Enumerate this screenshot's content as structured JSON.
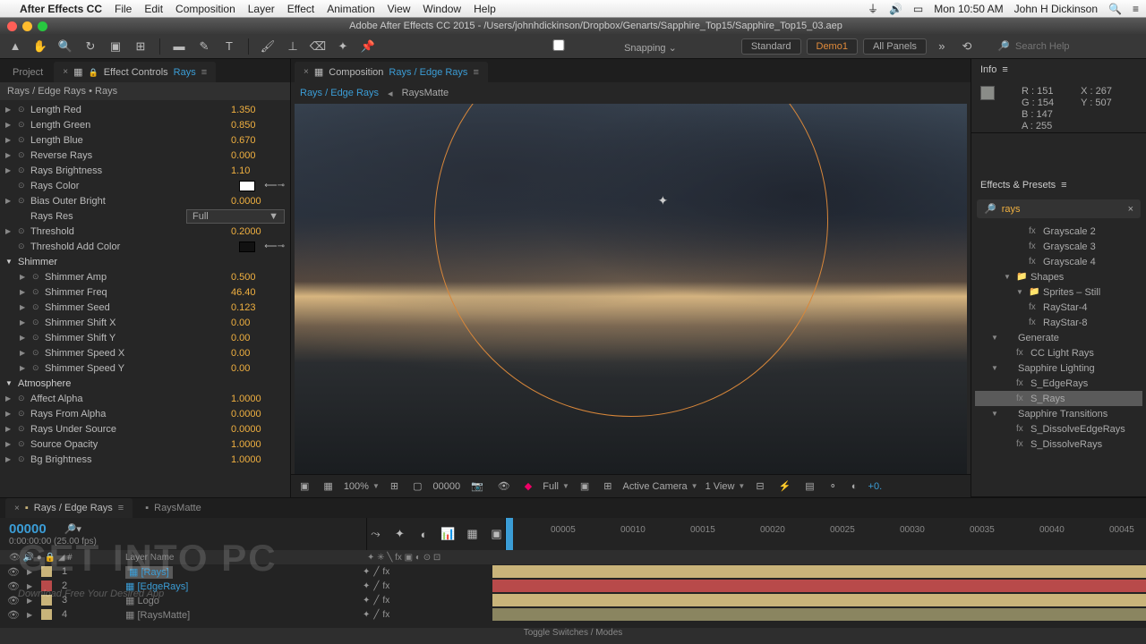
{
  "menubar": {
    "apple": "",
    "app": "After Effects CC",
    "items": [
      "File",
      "Edit",
      "Composition",
      "Layer",
      "Effect",
      "Animation",
      "View",
      "Window",
      "Help"
    ],
    "clock": "Mon 10:50 AM",
    "user": "John H Dickinson"
  },
  "titlebar": "Adobe After Effects CC 2015 - /Users/johnhdickinson/Dropbox/Genarts/Sapphire_Top15/Sapphire_Top15_03.aep",
  "toolbar": {
    "snapping": "Snapping",
    "standard": "Standard",
    "workspace": "Demo1",
    "allpanels": "All Panels",
    "search_placeholder": "Search Help"
  },
  "left": {
    "tab_project": "Project",
    "tab_ec": "Effect Controls",
    "tab_ec_target": "Rays",
    "subheader": "Rays / Edge Rays • Rays",
    "params": [
      {
        "t": "p",
        "label": "Length Red",
        "val": "1.350"
      },
      {
        "t": "p",
        "label": "Length Green",
        "val": "0.850"
      },
      {
        "t": "p",
        "label": "Length Blue",
        "val": "0.670"
      },
      {
        "t": "p",
        "label": "Reverse Rays",
        "val": "0.000"
      },
      {
        "t": "p",
        "label": "Rays Brightness",
        "val": "1.10"
      },
      {
        "t": "c",
        "label": "Rays Color",
        "swatch": "light"
      },
      {
        "t": "p",
        "label": "Bias Outer Bright",
        "val": "0.0000"
      },
      {
        "t": "d",
        "label": "Rays Res",
        "val": "Full"
      },
      {
        "t": "p",
        "label": "Threshold",
        "val": "0.2000"
      },
      {
        "t": "c",
        "label": "Threshold Add Color",
        "swatch": "dark"
      },
      {
        "t": "s",
        "label": "Shimmer"
      },
      {
        "t": "p",
        "label": "Shimmer Amp",
        "val": "0.500",
        "i": 1
      },
      {
        "t": "p",
        "label": "Shimmer Freq",
        "val": "46.40",
        "i": 1
      },
      {
        "t": "p",
        "label": "Shimmer Seed",
        "val": "0.123",
        "i": 1
      },
      {
        "t": "p",
        "label": "Shimmer Shift X",
        "val": "0.00",
        "i": 1
      },
      {
        "t": "p",
        "label": "Shimmer Shift Y",
        "val": "0.00",
        "i": 1
      },
      {
        "t": "p",
        "label": "Shimmer Speed X",
        "val": "0.00",
        "i": 1
      },
      {
        "t": "p",
        "label": "Shimmer Speed Y",
        "val": "0.00",
        "i": 1
      },
      {
        "t": "s",
        "label": "Atmosphere"
      },
      {
        "t": "p",
        "label": "Affect Alpha",
        "val": "1.0000"
      },
      {
        "t": "p",
        "label": "Rays From Alpha",
        "val": "0.0000"
      },
      {
        "t": "p",
        "label": "Rays Under Source",
        "val": "0.0000"
      },
      {
        "t": "p",
        "label": "Source Opacity",
        "val": "1.0000"
      },
      {
        "t": "p",
        "label": "Bg Brightness",
        "val": "1.0000"
      }
    ]
  },
  "center": {
    "tab": "Composition",
    "crumb1": "Rays / Edge Rays",
    "crumb_active": "Rays / Edge Rays",
    "crumb_next": "RaysMatte",
    "zoom": "100%",
    "timecode": "00000",
    "res": "Full",
    "camera": "Active Camera",
    "views": "1 View",
    "exp": "+0."
  },
  "right": {
    "info": "Info",
    "r": "R : 151",
    "g": "G : 154",
    "b": "B : 147",
    "a": "A : 255",
    "x": "X : 267",
    "y": "Y : 507",
    "ep": "Effects & Presets",
    "search": "rays",
    "tree": [
      {
        "t": "i",
        "label": "Grayscale 2",
        "ind": 3
      },
      {
        "t": "i",
        "label": "Grayscale 3",
        "ind": 3
      },
      {
        "t": "i",
        "label": "Grayscale 4",
        "ind": 3
      },
      {
        "t": "f",
        "label": "Shapes",
        "ind": 2,
        "open": true
      },
      {
        "t": "f",
        "label": "Sprites – Still",
        "ind": 3,
        "open": true
      },
      {
        "t": "i",
        "label": "RayStar-4",
        "ind": 3
      },
      {
        "t": "i",
        "label": "RayStar-8",
        "ind": 3
      },
      {
        "t": "g",
        "label": "Generate",
        "ind": 1,
        "open": true
      },
      {
        "t": "i",
        "label": "CC Light Rays",
        "ind": 2
      },
      {
        "t": "g",
        "label": "Sapphire Lighting",
        "ind": 1,
        "open": true
      },
      {
        "t": "i",
        "label": "S_EdgeRays",
        "ind": 2
      },
      {
        "t": "i",
        "label": "S_Rays",
        "ind": 2,
        "sel": true
      },
      {
        "t": "g",
        "label": "Sapphire Transitions",
        "ind": 1,
        "open": true
      },
      {
        "t": "i",
        "label": "S_DissolveEdgeRays",
        "ind": 2
      },
      {
        "t": "i",
        "label": "S_DissolveRays",
        "ind": 2
      }
    ]
  },
  "timeline": {
    "tab1": "Rays / Edge Rays",
    "tab2": "RaysMatte",
    "tc": "00000",
    "fps": "0:00:00:00 (25.00 fps)",
    "col_label": "Layer Name",
    "toggle": "Toggle Switches / Modes",
    "ticks": [
      "00005",
      "00010",
      "00015",
      "00020",
      "00025",
      "00030",
      "00035",
      "00040",
      "00045"
    ],
    "layers": [
      {
        "n": "1",
        "name": "[Rays]",
        "color": "#c9b47a",
        "sel": true,
        "barcolor": "#c9b47a"
      },
      {
        "n": "2",
        "name": "[EdgeRays]",
        "color": "#b84a4a",
        "barcolor": "#b84a4a"
      },
      {
        "n": "3",
        "name": "Logo",
        "color": "#c9b47a",
        "barcolor": "#c9b47a",
        "mute": true
      },
      {
        "n": "4",
        "name": "[RaysMatte]",
        "color": "#c9b47a",
        "barcolor": "#8a8560",
        "mute": true
      }
    ]
  },
  "watermark": "GET INTO PC",
  "watermark2": "Download Free Your Desired App"
}
